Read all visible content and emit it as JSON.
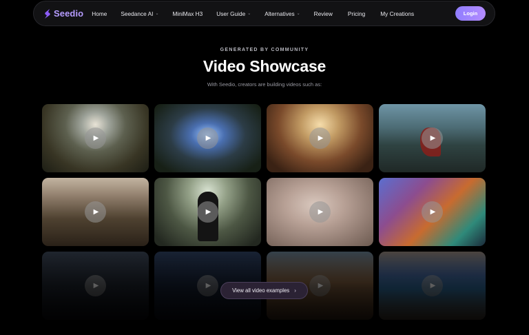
{
  "nav": {
    "logo_text": "Seedio",
    "items": [
      {
        "label": "Home",
        "dropdown": false
      },
      {
        "label": "Seedance AI",
        "dropdown": true
      },
      {
        "label": "MiniMax H3",
        "dropdown": false
      },
      {
        "label": "User Guide",
        "dropdown": true
      },
      {
        "label": "Alternatives",
        "dropdown": true
      },
      {
        "label": "Review",
        "dropdown": false
      },
      {
        "label": "Pricing",
        "dropdown": false
      },
      {
        "label": "My Creations",
        "dropdown": false
      }
    ],
    "chevron": "⌄",
    "login_label": "Login"
  },
  "header": {
    "eyebrow": "GENERATED BY COMMUNITY",
    "title": "Video Showcase",
    "subtitle": "With Seedio, creators are building videos such as:"
  },
  "showcase": {
    "play_icon": "▶",
    "videos_count_visible": 12
  },
  "view_all": {
    "label": "View all video examples",
    "arrow": "›"
  },
  "colors": {
    "brand": "#8b5cf6",
    "login_gradient_start": "#8f7dff",
    "login_gradient_end": "#b48cff"
  }
}
